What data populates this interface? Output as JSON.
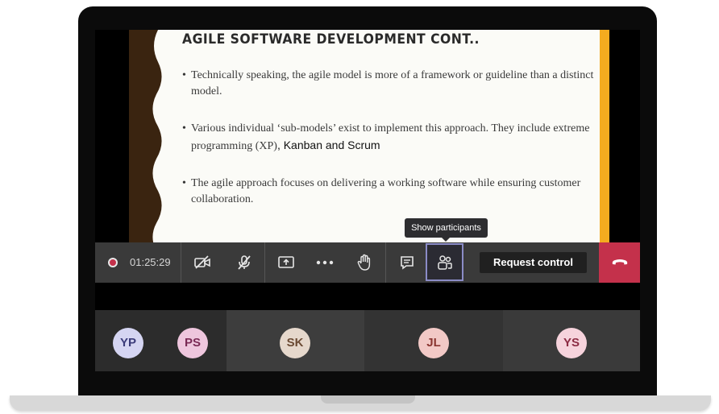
{
  "slide": {
    "title": "AGILE SOFTWARE DEVELOPMENT CONT..",
    "bullets": [
      {
        "text": "Technically speaking, the agile model is more of a framework or guideline than a distinct model."
      },
      {
        "text_pre": "Various individual ‘sub-models’ exist to implement this approach. They include extreme programming (XP)",
        "text_post": ", Kanban and Scrum"
      },
      {
        "text": "The agile approach focuses on delivering a working software while ensuring customer collaboration."
      }
    ],
    "colors": {
      "left_strip": "#3a2410",
      "right_strip": "#f4ab1f"
    }
  },
  "meeting": {
    "tooltip": "Show participants",
    "timer": "01:25:29",
    "request_control_label": "Request control",
    "icons": [
      "record-icon",
      "video-off-icon",
      "mic-off-icon",
      "share-screen-icon",
      "more-options-icon",
      "raise-hand-icon",
      "chat-icon",
      "participants-icon",
      "hang-up-icon"
    ],
    "colors": {
      "leave": "#c4314b",
      "bar": "#3a3a3a",
      "active_border": "#8b8cc7"
    }
  },
  "participants": [
    {
      "initials": "YP",
      "bg": "#d5d5f2",
      "fg": "#3b3b7a"
    },
    {
      "initials": "PS",
      "bg": "#eec6dd",
      "fg": "#7a2a55"
    },
    {
      "initials": "SK",
      "bg": "#e6d8cc",
      "fg": "#6b4a33"
    },
    {
      "initials": "JL",
      "bg": "#f2c9c6",
      "fg": "#8a3530"
    },
    {
      "initials": "YS",
      "bg": "#f6d3dc",
      "fg": "#8c2b43"
    }
  ]
}
